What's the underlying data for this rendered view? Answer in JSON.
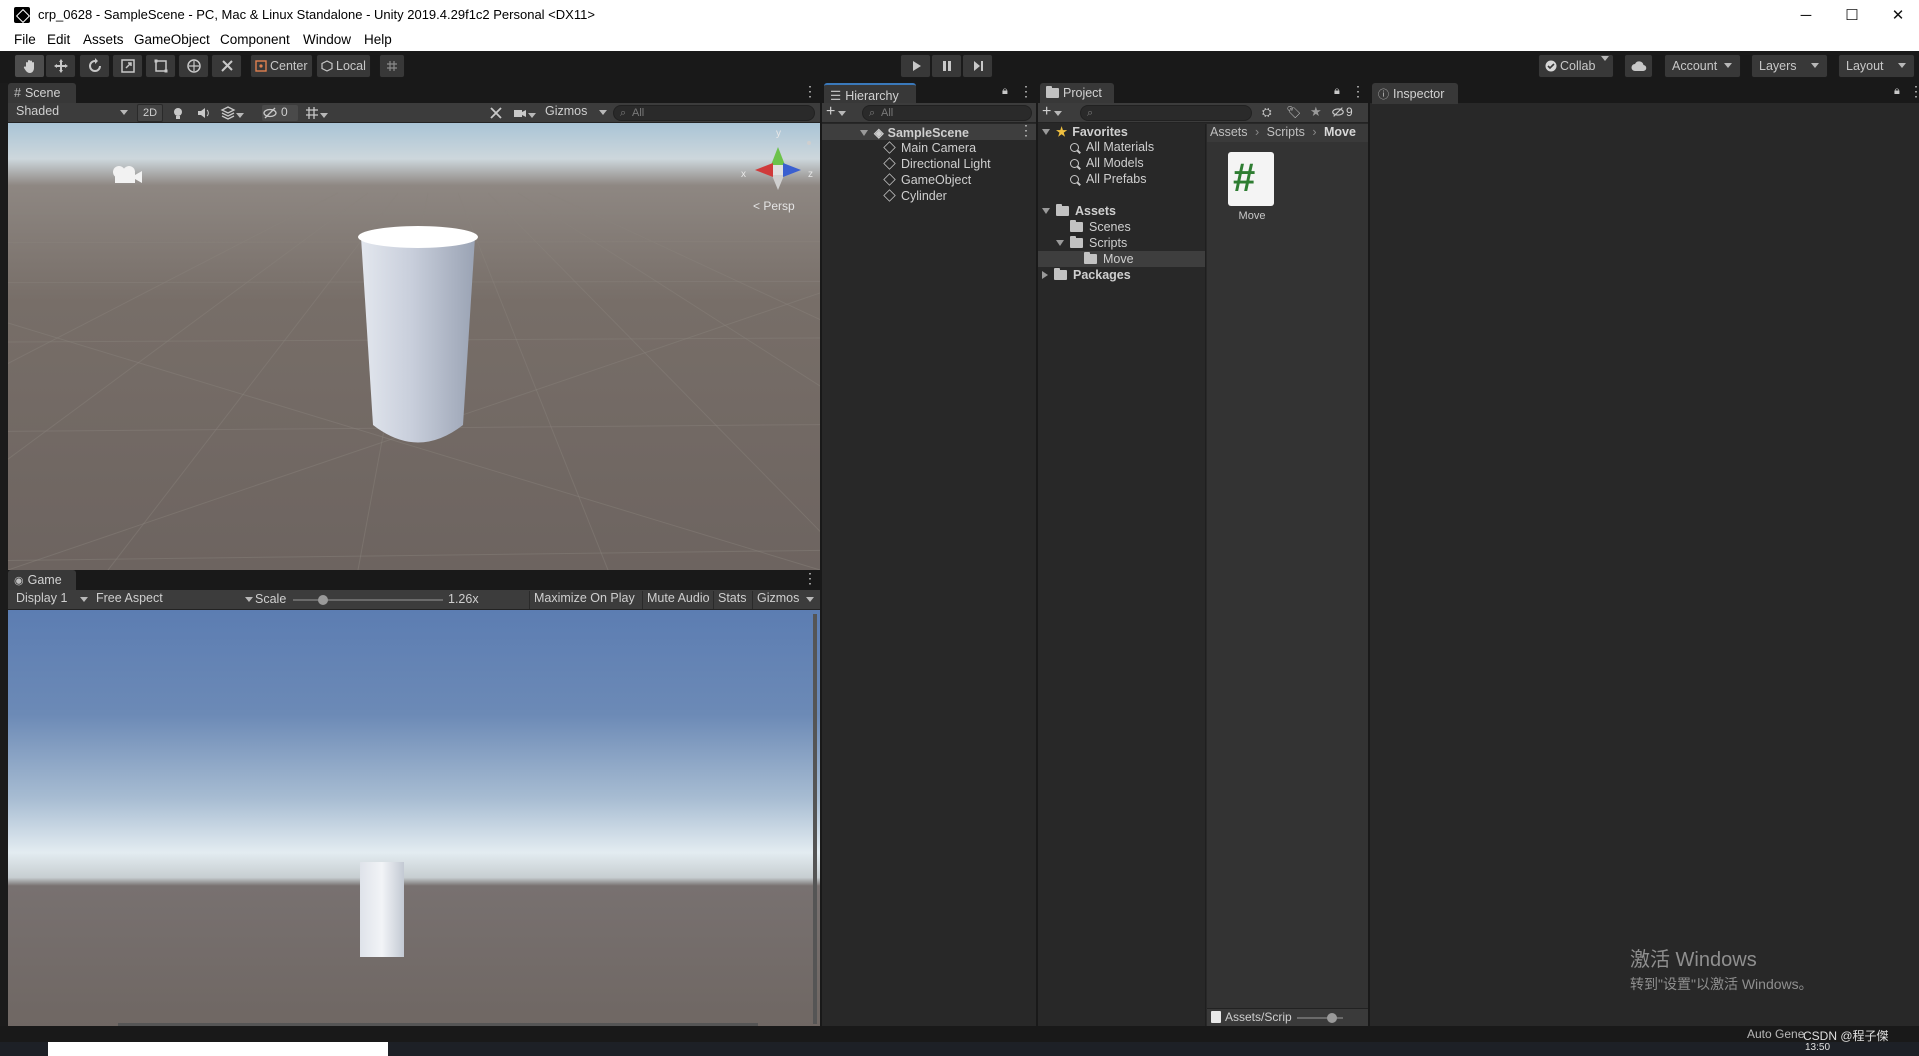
{
  "window": {
    "title": "crp_0628 - SampleScene - PC, Mac & Linux Standalone - Unity 2019.4.29f1c2 Personal <DX11>",
    "minimize_glyph": "─",
    "maximize_glyph": "☐",
    "close_glyph": "✕"
  },
  "menu": [
    "File",
    "Edit",
    "Assets",
    "GameObject",
    "Component",
    "Window",
    "Help"
  ],
  "toolbar": {
    "pivot_label": "Center",
    "space_label": "Local",
    "collab_label": "Collab",
    "account_label": "Account",
    "layers_label": "Layers",
    "layout_label": "Layout"
  },
  "scene": {
    "tab_label": "Scene",
    "shading_mode": "Shaded",
    "mode_2d": "2D",
    "hidden_count": "0",
    "gizmos_label": "Gizmos",
    "search_placeholder": "All",
    "persp_label": "< Persp",
    "axis_y": "y",
    "axis_x": "x",
    "axis_z": "z"
  },
  "game": {
    "tab_label": "Game",
    "display": "Display 1",
    "aspect": "Free Aspect",
    "scale_label": "Scale",
    "scale_value": "1.26x",
    "scale_fraction": 0.2,
    "maximize_on_play": "Maximize On Play",
    "mute_audio": "Mute Audio",
    "stats": "Stats",
    "gizmos": "Gizmos"
  },
  "hierarchy": {
    "tab_label": "Hierarchy",
    "search_placeholder": "All",
    "scene_name": "SampleScene",
    "items": [
      "Main Camera",
      "Directional Light",
      "GameObject",
      "Cylinder"
    ]
  },
  "project": {
    "tab_label": "Project",
    "hidden_count": "9",
    "favorites_label": "Favorites",
    "favorites": [
      "All Materials",
      "All Models",
      "All Prefabs"
    ],
    "assets_label": "Assets",
    "assets_children": [
      "Scenes",
      "Scripts"
    ],
    "scripts_children": [
      "Move"
    ],
    "packages_label": "Packages",
    "breadcrumb": [
      "Assets",
      "Scripts",
      "Move"
    ],
    "asset_items": [
      {
        "name": "Move",
        "glyph": "#"
      }
    ],
    "footer_path": "Assets/Scrip"
  },
  "inspector": {
    "tab_label": "Inspector"
  },
  "watermark": {
    "line1": "激活 Windows",
    "line2": "转到\"设置\"以激活 Windows。"
  },
  "status_bar": {
    "text": "Auto Gene",
    "overlay": "CSDN @程子傑",
    "clock": "13:50"
  },
  "colors": {
    "accent_blue": "#3a79bb",
    "panel_bg": "#282828",
    "selected_row": "#3e3e3e",
    "script_green": "#2e7d32"
  }
}
